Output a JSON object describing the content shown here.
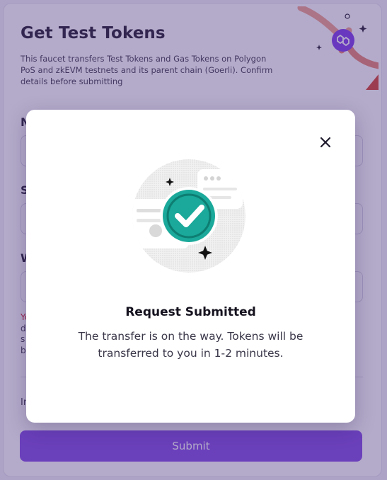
{
  "form": {
    "title": "Get Test Tokens",
    "description": "This faucet transfers Test Tokens and Gas Tokens on Polygon PoS and zkEVM testnets and its parent chain (Goerli). Confirm details before submitting",
    "fields": [
      {
        "label_visible": "N"
      },
      {
        "label_visible": "S"
      },
      {
        "label_visible": "W"
      }
    ],
    "warning_red_visible": "Yo",
    "warning_lines_visible": [
      "d",
      "s",
      "b"
    ],
    "info_visible": "In",
    "submit_label": "Submit"
  },
  "modal": {
    "title": "Request Submitted",
    "message": "The transfer is on the way. Tokens will be transferred to you in 1-2 minutes."
  },
  "colors": {
    "brand_purple": "#8247e5",
    "success_teal": "#1aa99a",
    "warning_red": "#d3202e"
  },
  "icons": {
    "close": "close-icon",
    "success": "check-circle-icon",
    "hero": "polygon-logo-icon"
  }
}
